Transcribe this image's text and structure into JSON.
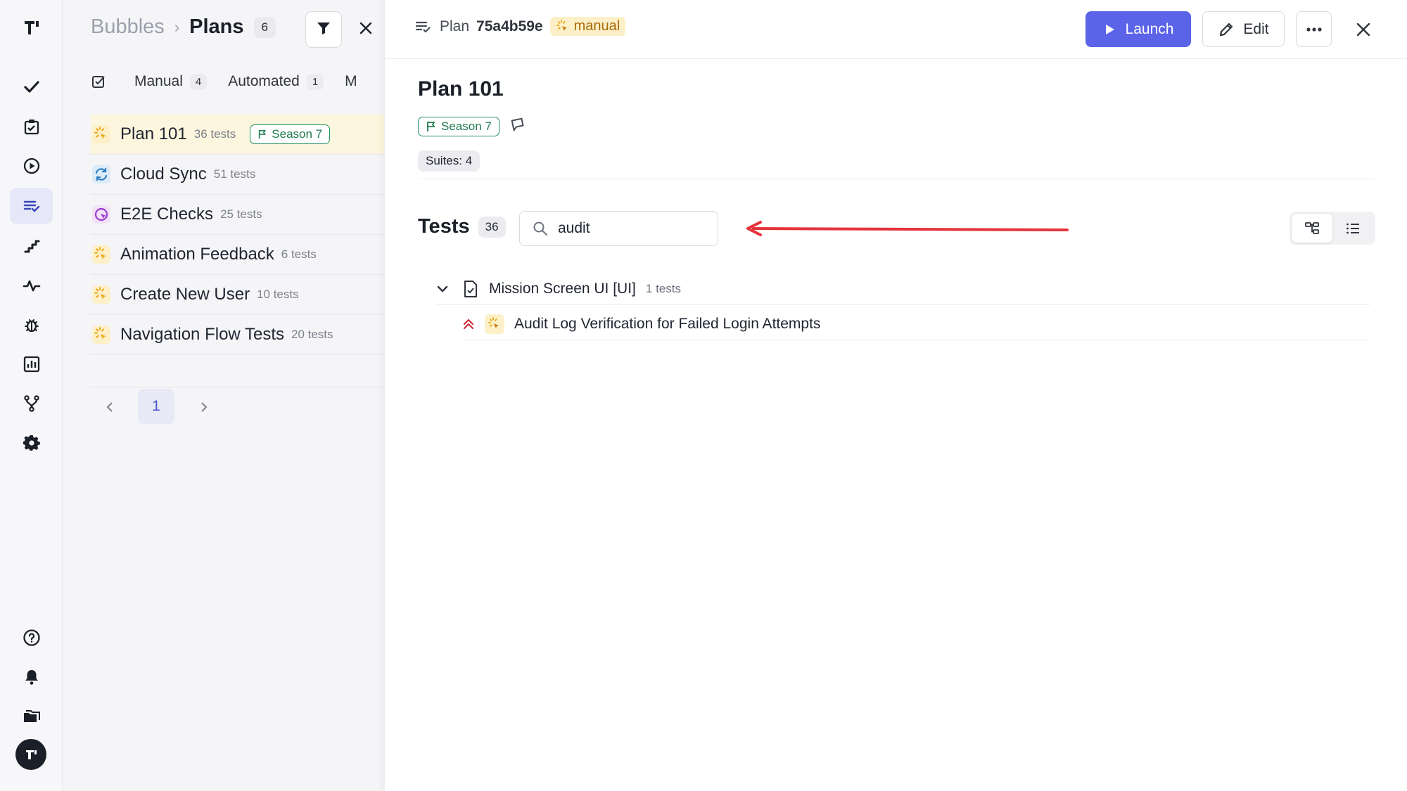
{
  "sidebar": {
    "nav": [
      "logo",
      "check",
      "clipboard",
      "play",
      "plans",
      "steps",
      "activity",
      "bug",
      "reports",
      "branches",
      "settings"
    ],
    "bottom": [
      "help",
      "notifications",
      "folders",
      "avatar"
    ]
  },
  "list_panel": {
    "breadcrumb": {
      "project": "Bubbles",
      "separator": "›",
      "current": "Plans",
      "count": "6"
    },
    "tabs": [
      {
        "label": "Manual",
        "count": "4"
      },
      {
        "label": "Automated",
        "count": "1"
      },
      {
        "label": "M",
        "count": ""
      }
    ],
    "plans": [
      {
        "name": "Plan 101",
        "tests": "36 tests",
        "badge": "Season 7",
        "icon": "manual",
        "color": "#e9a514"
      },
      {
        "name": "Cloud Sync",
        "tests": "51 tests",
        "badge": "",
        "icon": "sync",
        "color": "#2f7fc4"
      },
      {
        "name": "E2E Checks",
        "tests": "25 tests",
        "badge": "",
        "icon": "automated",
        "color": "#9b3ccf"
      },
      {
        "name": "Animation Feedback",
        "tests": "6 tests",
        "badge": "",
        "icon": "manual",
        "color": "#e9a514"
      },
      {
        "name": "Create New User",
        "tests": "10 tests",
        "badge": "",
        "icon": "manual",
        "color": "#e9a514"
      },
      {
        "name": "Navigation Flow Tests",
        "tests": "20 tests",
        "badge": "",
        "icon": "manual",
        "color": "#e9a514"
      }
    ],
    "pagination": {
      "current": "1"
    }
  },
  "detail": {
    "header": {
      "label": "Plan",
      "id": "75a4b59e",
      "type": "manual"
    },
    "buttons": {
      "launch": "Launch",
      "edit": "Edit"
    },
    "title": "Plan 101",
    "milestone": "Season 7",
    "suites": "Suites: 4",
    "tests": {
      "title": "Tests",
      "count": "36",
      "search_value": "audit",
      "groups": [
        {
          "name": "Mission Screen UI [UI]",
          "count": "1 tests",
          "items": [
            {
              "name": "Audit Log Verification for Failed Login Attempts",
              "priority": "high"
            }
          ]
        }
      ]
    }
  },
  "colors": {
    "accent": "#5b63e8",
    "manual": "#e9a514",
    "season": "#1f7a4f",
    "annotation_arrow": "#e5333b"
  }
}
